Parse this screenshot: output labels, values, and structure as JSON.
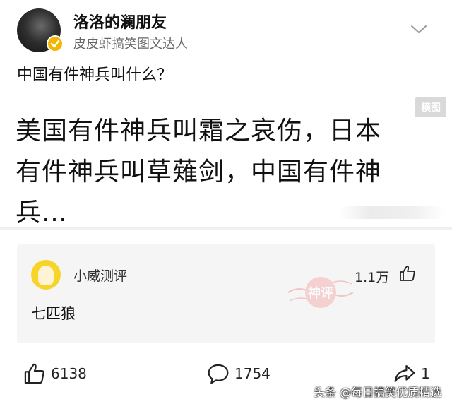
{
  "post": {
    "author_name": "洛洛的澜朋友",
    "author_tag": "皮皮虾搞笑图文达人",
    "question": "中国有件神兵叫什么？",
    "answer_lines": [
      "美国有件神兵叫霜之哀伤，日本",
      "有件神兵叫草薙剑，中国有件神",
      "兵…"
    ],
    "watermark_small": "横图"
  },
  "comment": {
    "author": "小威测评",
    "likes": "1.1万",
    "text": "七匹狼",
    "stamp_text": "神评"
  },
  "footer": {
    "likes": "6138",
    "comments": "1754",
    "shares": "1"
  },
  "credit": "头条 @每日搞笑优质精选",
  "colors": {
    "badge": "#f2b705",
    "stamp": "#e36b6b",
    "comment_bg": "#f5f5f5"
  }
}
